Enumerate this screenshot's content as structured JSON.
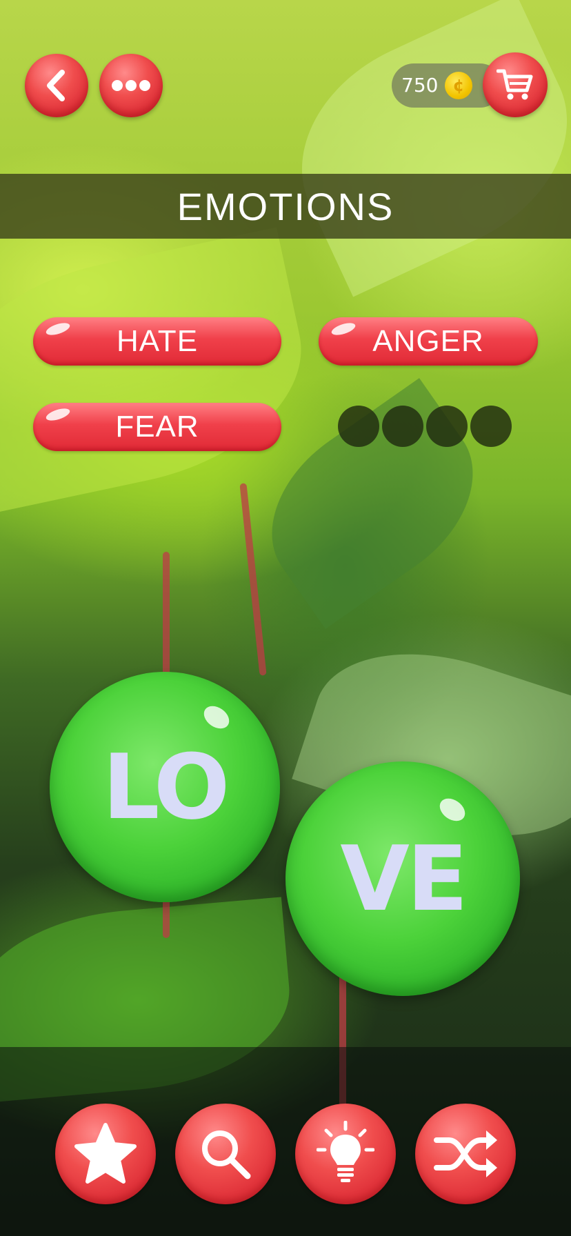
{
  "header": {
    "back_icon": "back-chevron-icon",
    "menu_icon": "more-dots-icon",
    "coins": "750",
    "coin_symbol": "¢",
    "shop_icon": "shopping-cart-icon"
  },
  "category": {
    "title": "EMOTIONS"
  },
  "found_words": [
    {
      "label": "HATE"
    },
    {
      "label": "ANGER"
    },
    {
      "label": "FEAR"
    }
  ],
  "hidden_word": {
    "letter_count": 4
  },
  "tiles": [
    {
      "text": "LO"
    },
    {
      "text": "VE"
    }
  ],
  "toolbar": {
    "icons": [
      "star-icon",
      "magnifier-icon",
      "lightbulb-icon",
      "shuffle-icon"
    ]
  },
  "colors": {
    "accent_red": "#e8343e",
    "tile_green": "#3cc834",
    "tile_text": "#d8dcf7"
  }
}
